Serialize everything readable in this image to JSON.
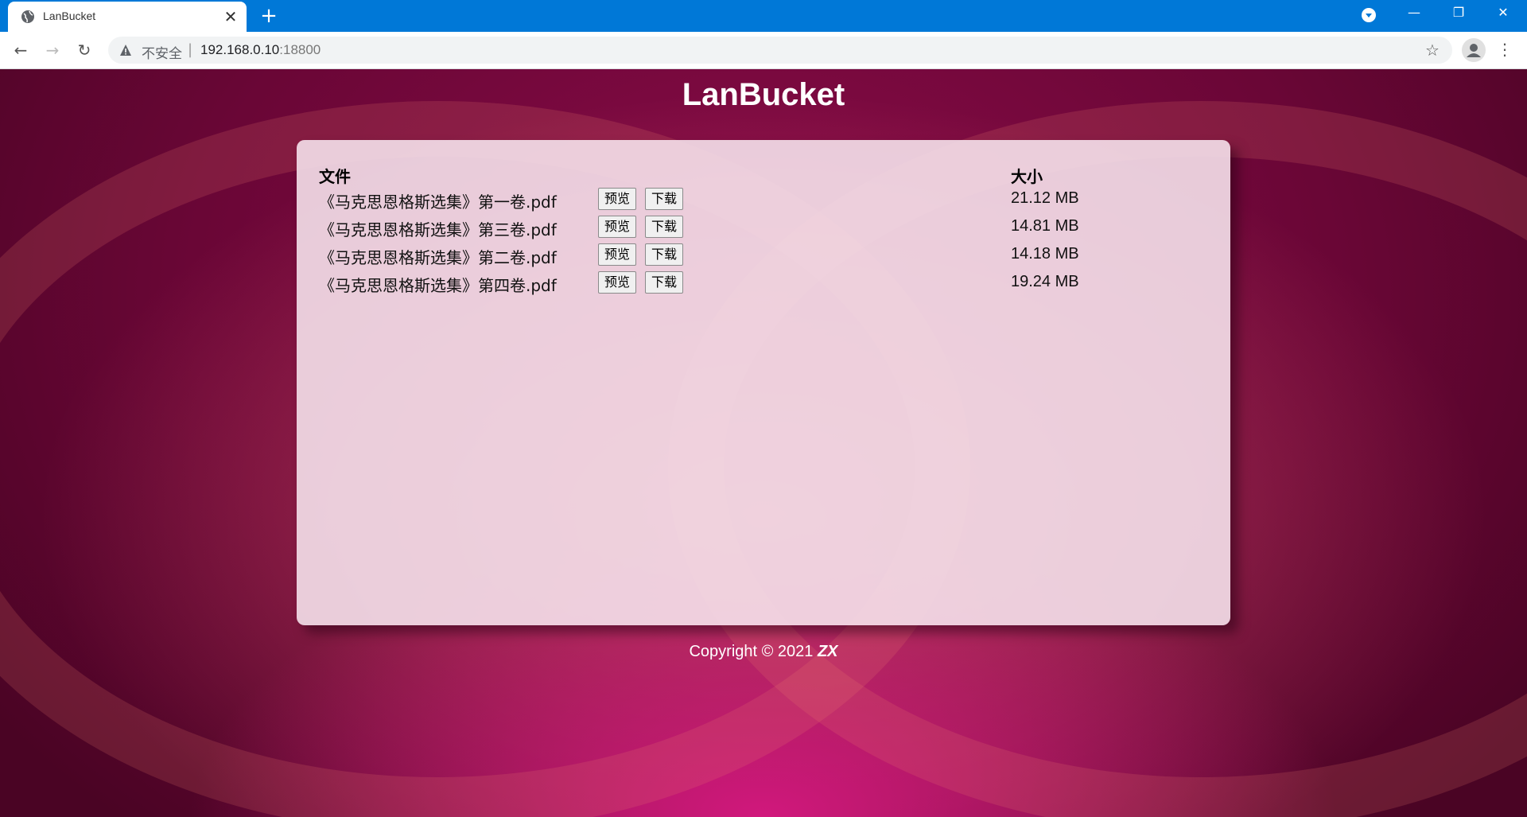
{
  "browser": {
    "tab_title": "LanBucket",
    "tab_close": "✕",
    "new_tab": "+",
    "address": {
      "security_label": "不安全",
      "separator": "|",
      "host": "192.168.0.10",
      "port": ":18800"
    },
    "window_controls": {
      "minimize": "—",
      "maximize": "❐",
      "close": "✕"
    },
    "colors": {
      "titlebar": "#0078d7"
    }
  },
  "page": {
    "title": "LanBucket",
    "table": {
      "headers": {
        "file": "文件",
        "size": "大小"
      },
      "preview_label": "预览",
      "download_label": "下载",
      "rows": [
        {
          "name": "《马克思恩格斯选集》第一卷.pdf",
          "size": "21.12 MB"
        },
        {
          "name": "《马克思恩格斯选集》第三卷.pdf",
          "size": "14.81 MB"
        },
        {
          "name": "《马克思恩格斯选集》第二卷.pdf",
          "size": "14.18 MB"
        },
        {
          "name": "《马克思恩格斯选集》第四卷.pdf",
          "size": "19.24 MB"
        }
      ]
    },
    "footer": {
      "copyright": "Copyright © 2021 ",
      "author": "ZX"
    }
  }
}
